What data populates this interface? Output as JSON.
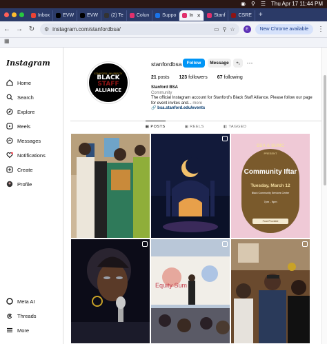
{
  "menubar": {
    "datetime": "Thu Apr 17  11:44 PM"
  },
  "browser": {
    "tabs": [
      {
        "label": "Inbox",
        "color": "#ea4335"
      },
      {
        "label": "EVW",
        "color": "#000000"
      },
      {
        "label": "EVW",
        "color": "#000000"
      },
      {
        "label": "(2) Te",
        "color": "#333333"
      },
      {
        "label": "Colun",
        "color": "#e1306c"
      },
      {
        "label": "Suppo",
        "color": "#1a73e8"
      },
      {
        "label": "In",
        "color": "#e1306c"
      },
      {
        "label": "Stanf",
        "color": "#e1306c"
      },
      {
        "label": "CSRE",
        "color": "#8c1515"
      }
    ],
    "url": "instagram.com/stanfordbsa/",
    "profile_initial": "E",
    "update_label": "New Chrome available"
  },
  "sidebar": {
    "logo": "Instagram",
    "items": [
      {
        "label": "Home",
        "icon": "home-icon"
      },
      {
        "label": "Search",
        "icon": "search-icon"
      },
      {
        "label": "Explore",
        "icon": "explore-icon"
      },
      {
        "label": "Reels",
        "icon": "reels-icon"
      },
      {
        "label": "Messages",
        "icon": "messages-icon"
      },
      {
        "label": "Notifications",
        "icon": "heart-icon"
      },
      {
        "label": "Create",
        "icon": "plus-icon"
      },
      {
        "label": "Profile",
        "icon": "avatar-icon"
      }
    ],
    "bottom_items": [
      {
        "label": "Meta AI",
        "icon": "meta-ai-icon"
      },
      {
        "label": "Threads",
        "icon": "threads-icon"
      },
      {
        "label": "More",
        "icon": "menu-icon"
      }
    ]
  },
  "profile": {
    "username": "stanfordbsa",
    "follow_label": "Follow",
    "message_label": "Message",
    "add_user_label": "+₁",
    "posts_count": "21",
    "posts_label": "posts",
    "followers_count": "123",
    "followers_label": "followers",
    "following_count": "67",
    "following_label": "following",
    "display_name": "Stanford BSA",
    "category": "Community",
    "bio_text": "The official Instagram account for Stanford's Black Staff Alliance. Please follow our page for event invites and...",
    "bio_more": "more",
    "link": "bsa.stanford.edu/events",
    "avatar": {
      "line1": "STANFORD UNIVERSITY",
      "line2": "BLACK",
      "line3": "STAFF",
      "line4": "ALLIANCE"
    }
  },
  "profile_tabs": [
    "POSTS",
    "REELS",
    "TAGGED"
  ],
  "posts": {
    "iftar": {
      "t1": "SSA & SUMC",
      "t2": "PRESENT",
      "t3": "Community Iftar",
      "t4": "Tuesday, March 12",
      "t5": "Black Community Services Center",
      "t6": "7pm - 9pm",
      "pill": "Food Provided"
    },
    "event_slide_text": "Equity Sum"
  }
}
